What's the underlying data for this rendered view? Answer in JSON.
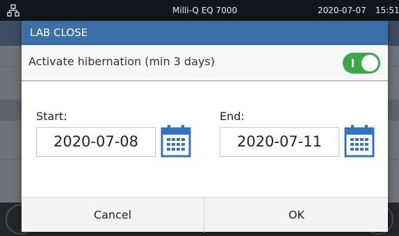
{
  "statusbar": {
    "network_icon": "network-icon",
    "device_name": "Milli-Q EQ 7000",
    "date": "2020-07-07",
    "time": "15:51"
  },
  "dialog": {
    "title": "LAB CLOSE",
    "hibernation_label": "Activate hibernation (min 3 days)",
    "hibernation_enabled": true,
    "toggle_color": "#37a947",
    "start_label": "Start:",
    "start_value": "2020-07-08",
    "end_label": "End:",
    "end_value": "2020-07-11",
    "calendar_icon": "calendar-icon",
    "cancel_label": "Cancel",
    "ok_label": "OK"
  },
  "colors": {
    "header": "#3b6fa8",
    "calendar": "#2e73c6",
    "statusbar": "#10161c"
  }
}
